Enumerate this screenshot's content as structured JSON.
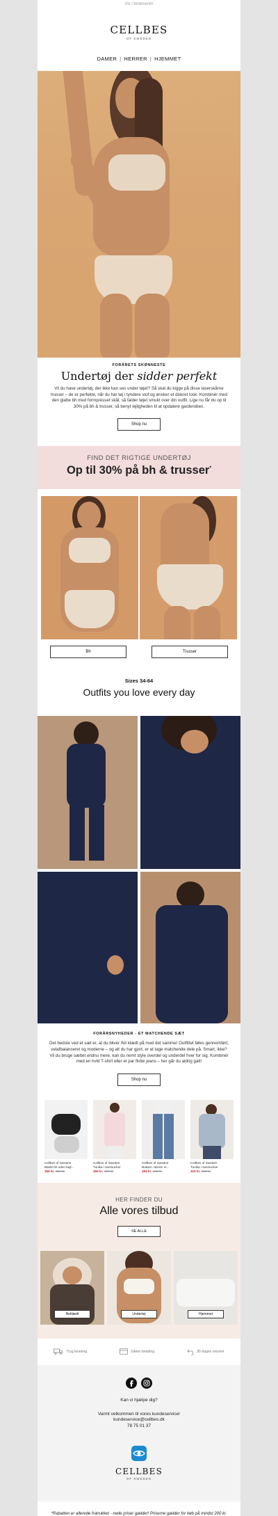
{
  "topbar": {
    "view_in_browser": "Vis i browseren"
  },
  "brand": {
    "name": "CELLBES",
    "sub": "OF SWEDEN"
  },
  "nav": {
    "items": [
      "DAMER",
      "HERRER",
      "HJEMMET"
    ]
  },
  "hero_section": {
    "kicker": "FORÅRETS SKØNNESTE",
    "title_a": "Undertøj der",
    "title_b": "sidder perfekt",
    "body": "Vil du have undertøj, der ikke kan ses under tøjet? Så skal du kigge på disse laserskårne trusser – de er perfekte, når du har tøj i tyndere stof og ønsker et diskret look. Kombinér med den glatte bh med formpresset skål, så falder tøjet smukt over din outfit. Lige nu får du op til 30% på bh & trusser, så benyt lejligheden til at opdatere garderoben.",
    "button": "Shop nu"
  },
  "promo_band": {
    "line1": "FIND DET RIGTIGE UNDERTØJ",
    "line2": "Op til 30% på bh & trusser",
    "mark": "*"
  },
  "category_buttons": {
    "bh": "Bh",
    "trusser": "Trusser"
  },
  "outfits": {
    "kicker": "Sizes 34-64",
    "title": "Outfits you love every day"
  },
  "matching_set": {
    "kicker": "FORÅRSNYHEDER - ET MATCHENDE SÆT",
    "body": "Det bedste ved et sæt er, at du bliver flot klædt på med det samme! Outfittet føles gennemført, velafbalanceret og moderne – og alt du har gjort, er at tage matchende dele på. Smart, ikke? Vil du bruge sættet endnu mere, kan du nemt style overdel og underdel hver for sig. Kombinér med en hvid T-shirt eller et par flotte jeans – her går du aldrig galt!",
    "button": "Shop nu"
  },
  "products": [
    {
      "brand": "Cellbes of Sweden",
      "name": "Bløde bh uden bøjl...",
      "price": "359 kr.",
      "old": "499 kr."
    },
    {
      "brand": "Cellbes of Sweden",
      "name": "Tunika i seersucker",
      "price": "359 kr.",
      "old": "449 kr."
    },
    {
      "brand": "Cellbes of Sweden",
      "name": "Bukser i denim m...",
      "price": "359 kr.",
      "old": "449 kr."
    },
    {
      "brand": "Cellbes of Sweden",
      "name": "Tunika i seersucker",
      "price": "319 kr.",
      "old": "449 kr."
    }
  ],
  "offers": {
    "kicker": "HER FINDER DU",
    "title": "Alle vores tilbud",
    "button": "SE ALLE"
  },
  "offer_tiles": [
    "Beklædt",
    "Undertøj",
    "Hjemmet"
  ],
  "usps": [
    "Tryg levering",
    "Sikker betaling",
    "30 dages returret"
  ],
  "footer": {
    "help": "Kan vi hjælpe dig?",
    "welcome": "Varmt velkommen til vores kundeservice!",
    "email": "kundeservice@cellbes.dk",
    "phone": "78 75 01 37",
    "disclaimer": "*Rabatten er allerede fratrukket - nede priser gælder! Priserne gælder for køb på mindst 200 kr. indtil 15.03.2026."
  },
  "colors": {
    "pink_band": "#f3dcdc",
    "cream": "#f7ebe6",
    "navy": "#1f2747",
    "sale_red": "#c0262a",
    "logo_blue": "#1a8ad1"
  }
}
